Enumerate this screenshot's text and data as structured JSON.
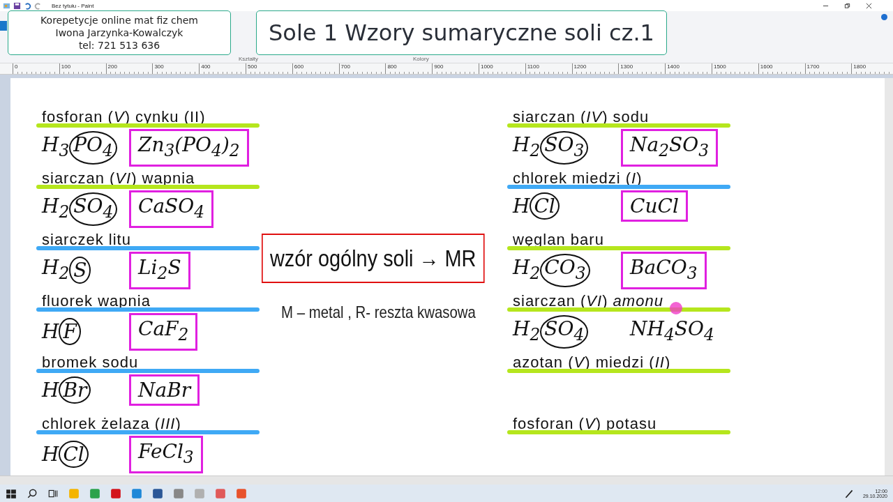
{
  "window": {
    "title": "Bez tytułu - Paint"
  },
  "ribbon_groups": [
    "Kształty",
    "Kolory"
  ],
  "contact_banner": {
    "lines": [
      "Korepetycje online mat fiz chem",
      "Iwona Jarzynka-Kowalczyk",
      "tel: 721 513 636"
    ]
  },
  "title_banner": {
    "text": "Sole 1 Wzory sumaryczne soli cz.1"
  },
  "ruler": {
    "ticks": [
      "0",
      "100",
      "200",
      "300",
      "400",
      "500",
      "600",
      "700",
      "800",
      "900",
      "1000",
      "1100",
      "1200",
      "1300",
      "1400",
      "1500",
      "1600",
      "1700",
      "1800"
    ]
  },
  "columns": [
    {
      "entries": [
        {
          "name": "fosforan (*V*) cynku (II)",
          "color": "#b5e61d",
          "acid_hydrogen": "H$_{3}$",
          "acid_residue": "PO$_{4}$",
          "salt": "Zn$_{3}$(PO$_{4}$)$_{2}$",
          "salt_boxed": true
        },
        {
          "name": "siarczan (*VI*) wapnia",
          "color": "#b5e61d",
          "acid_hydrogen": "H$_{2}$",
          "acid_residue": "SO$_{4}$",
          "salt": "CaSO$_{4}$",
          "salt_boxed": true
        },
        {
          "name": "siarczek litu",
          "color": "#3fa9f5",
          "acid_hydrogen": "H$_{2}$",
          "acid_residue": "S",
          "salt": "Li$_{2}$S",
          "salt_boxed": true
        },
        {
          "name": "fluorek wapnia",
          "color": "#3fa9f5",
          "acid_hydrogen": "H",
          "acid_residue": "F",
          "salt": "CaF$_{2}$",
          "salt_boxed": true
        },
        {
          "name": "bromek sodu",
          "color": "#3fa9f5",
          "acid_hydrogen": "H",
          "acid_residue": "Br",
          "salt": "NaBr",
          "salt_boxed": true
        },
        {
          "name": "chlorek żelaza (*III*)",
          "color": "#3fa9f5",
          "acid_hydrogen": "H",
          "acid_residue": "Cl",
          "salt": "FeCl$_{3}$",
          "salt_boxed": true
        }
      ]
    },
    {
      "entries": [
        {
          "name": "siarczan (*IV*) sodu",
          "color": "#b5e61d",
          "acid_hydrogen": "H$_{2}$",
          "acid_residue": "SO$_{3}$",
          "salt": "Na$_{2}$SO$_{3}$",
          "salt_boxed": true
        },
        {
          "name": "chlorek miedzi (*I*)",
          "color": "#3fa9f5",
          "acid_hydrogen": "H",
          "acid_residue": "Cl",
          "salt": "CuCl",
          "salt_boxed": true
        },
        {
          "name": "węglan baru",
          "color": "#b5e61d",
          "acid_hydrogen": "H$_{2}$",
          "acid_residue": "CO$_{3}$",
          "salt": "BaCO$_{3}$",
          "salt_boxed": true
        },
        {
          "name": "siarczan (*VI*) *amonu*",
          "color": "#b5e61d",
          "acid_hydrogen": "H$_{2}$",
          "acid_residue": "SO$_{4}$",
          "salt": "NH$_{4}$SO$_{4}$",
          "salt_boxed": false
        },
        {
          "name": "azotan (*V*) miedzi (*II*)",
          "color": "#b5e61d"
        },
        {
          "name": "fosforan (*V*) potasu",
          "color": "#b5e61d"
        }
      ]
    }
  ],
  "rule_box": {
    "text": "wzór ogólny soli → MR"
  },
  "legend": "M – metal , R- reszta kwasowa",
  "taskbar": {
    "time": "12:00",
    "date": "29.10.2020"
  }
}
